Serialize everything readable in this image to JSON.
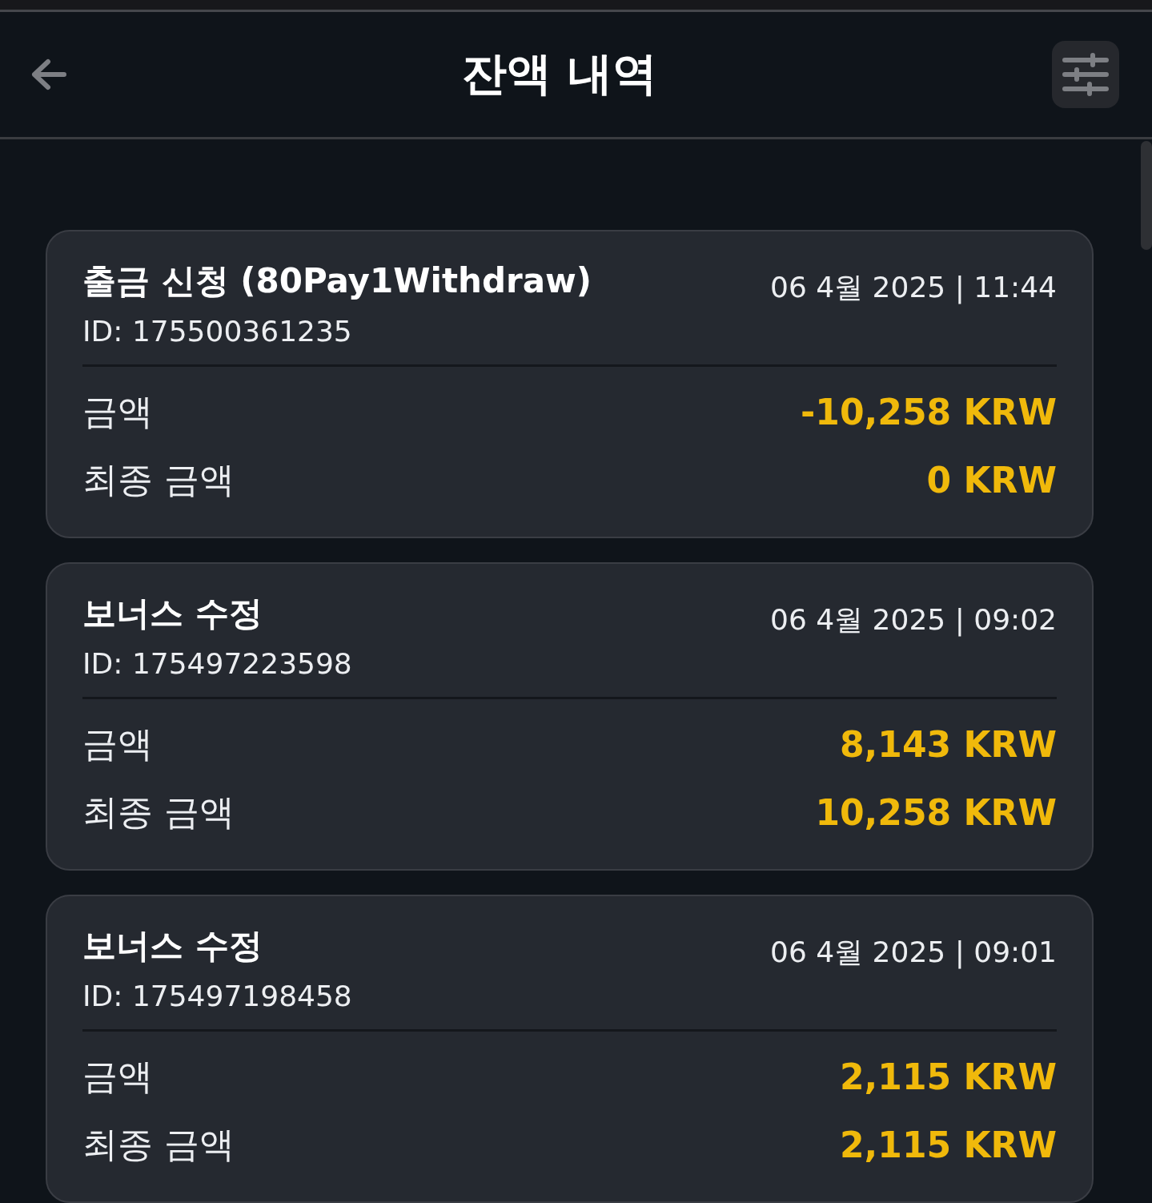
{
  "header": {
    "title": "잔액 내역"
  },
  "transactions": [
    {
      "title": "출금 신청 (80Pay1Withdraw)",
      "datetime": "06 4월 2025 | 11:44",
      "id": "ID: 175500361235",
      "amount_label": "금액",
      "amount": "-10,258 KRW",
      "final_label": "최종 금액",
      "final_amount": "0 KRW"
    },
    {
      "title": "보너스 수정",
      "datetime": "06 4월 2025 | 09:02",
      "id": "ID: 175497223598",
      "amount_label": "금액",
      "amount": "8,143 KRW",
      "final_label": "최종 금액",
      "final_amount": "10,258 KRW"
    },
    {
      "title": "보너스 수정",
      "datetime": "06 4월 2025 | 09:01",
      "id": "ID: 175497198458",
      "amount_label": "금액",
      "amount": "2,115 KRW",
      "final_label": "최종 금액",
      "final_amount": "2,115 KRW"
    }
  ]
}
